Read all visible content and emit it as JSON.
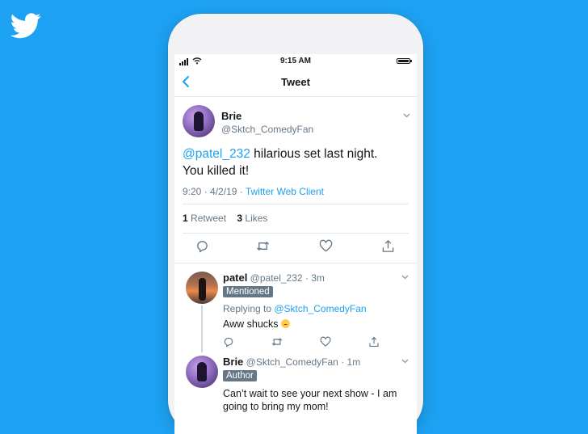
{
  "status_bar": {
    "time": "9:15 AM"
  },
  "nav": {
    "title": "Tweet"
  },
  "tweet": {
    "name": "Brie",
    "handle": "@Sktch_ComedyFan",
    "mention": "@patel_232",
    "text": " hilarious set last night. You killed it!",
    "time": "9:20 · 4/2/19 · ",
    "client": "Twitter Web Client",
    "retweets_count": "1",
    "retweets_label": " Retweet",
    "likes_count": "3",
    "likes_label": " Likes"
  },
  "replies": [
    {
      "name": "patel",
      "handle_time": " @patel_232 · 3m",
      "badge": "Mentioned",
      "replying_prefix": "Replying to ",
      "replying_handle": "@Sktch_ComedyFan",
      "text": "Aww shucks"
    },
    {
      "name": "Brie",
      "handle_time": " @Sktch_ComedyFan · 1m",
      "badge": "Author",
      "text": "Can’t wait to see your next show - I am going to bring my mom!"
    }
  ],
  "icons": [
    "twitter-logo",
    "back-chevron",
    "caret-down",
    "reply-icon",
    "retweet-icon",
    "like-icon",
    "share-icon"
  ],
  "colors": {
    "brand": "#1da1f2",
    "secondary_text": "#657786",
    "badge": "#657786"
  }
}
